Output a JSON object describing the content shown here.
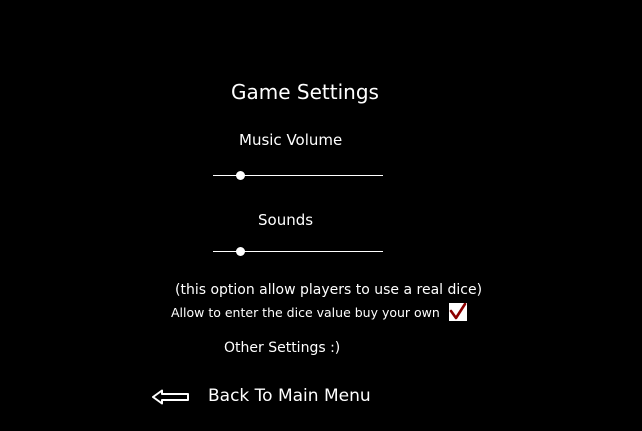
{
  "screen": {
    "title": "Game Settings",
    "background_color": "#000000",
    "text_color": "#ffffff"
  },
  "music": {
    "label": "Music Volume",
    "level": 0.16
  },
  "sounds": {
    "label": "Sounds",
    "level": 0.16
  },
  "dice_option": {
    "hint": "(this option allow players to use  a real dice)",
    "label": "Allow to enter the dice value  buy your own",
    "checked": true,
    "check_color": "#8b0000",
    "check_icon": "checkmark-icon"
  },
  "other_settings": {
    "label": "Other Settings :)"
  },
  "back": {
    "label": "Back To Main Menu",
    "icon": "left-arrow-icon"
  }
}
